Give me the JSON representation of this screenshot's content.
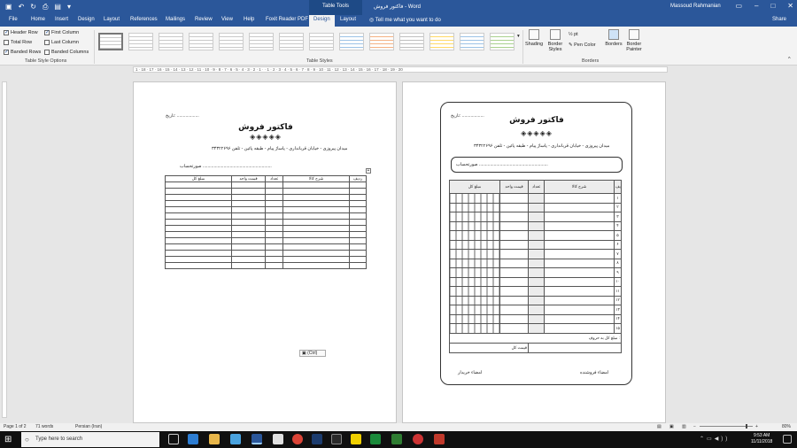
{
  "titlebar": {
    "context_tab": "Table Tools",
    "doc_title": "فاکتور فروش - Word",
    "user": "Massoud Rahmanian"
  },
  "tabs": {
    "items": [
      "File",
      "Home",
      "Insert",
      "Design",
      "Layout",
      "References",
      "Mailings",
      "Review",
      "View",
      "Help",
      "Foxit Reader PDF",
      "Design",
      "Layout"
    ],
    "tell_me": "Tell me what you want to do",
    "share": "Share"
  },
  "ribbon": {
    "options": [
      "Header Row",
      "Total Row",
      "Banded Rows",
      "First Column",
      "Last Column",
      "Banded Columns"
    ],
    "options_label": "Table Style Options",
    "styles_label": "Table Styles",
    "shading": "Shading",
    "border_styles": "Border Styles",
    "pen_weight": "½ pt",
    "pen_color": "Pen Color",
    "borders": "Borders",
    "border_painter": "Border Painter",
    "borders_label": "Borders"
  },
  "ruler": {
    "text": "1 · 18 · 17 · 16 · 15 · 14 · 13 · 12 · 11 · 10 · 9 · 8 · 7 · 6 · 5 · 4 · 3 · 2 · 1 ·     · 1 · 2 · 3 · 4 · 5 · 6 · 7 · 8 · 9 · 10 · 11 · 12 · 13 · 14 · 15 · 16 · 17 · 18 · 19 · 20"
  },
  "doc": {
    "date": "تاریخ: ..................",
    "title": "فاکتور فروش",
    "diamonds": "◈◈◈◈◈",
    "address": "میدان پیروزی - خیابان قربانداری - پاساژ پیام - طبقه پائین - تلفن ۳۴۳۲۲۶۹۶",
    "customer": "صورتحساب ........................................................",
    "headers": [
      "ردیف",
      "شرح کالا",
      "تعداد",
      "قیمت واحد",
      "مبلغ کل"
    ],
    "row_numbers": [
      "۱",
      "۲",
      "۳",
      "۴",
      "۵",
      "۶",
      "۷",
      "۸",
      "۹",
      "۱۰",
      "۱۱",
      "۱۲",
      "۱۳",
      "۱۴",
      "۱۵"
    ],
    "amount_in_words": "مبلغ کل به حروف :",
    "total_label": "قیمت کل",
    "buyer_sign": "امضاء خریدار",
    "seller_sign": "امضاء فروشنده",
    "paste_tag": "(Ctrl)"
  },
  "statusbar": {
    "page": "Page 1 of 2",
    "words": "71 words",
    "language": "Persian (Iran)",
    "zoom": "80%"
  },
  "taskbar": {
    "search_placeholder": "Type here to search",
    "time": "9:53 AM",
    "date": "11/11/2018"
  }
}
